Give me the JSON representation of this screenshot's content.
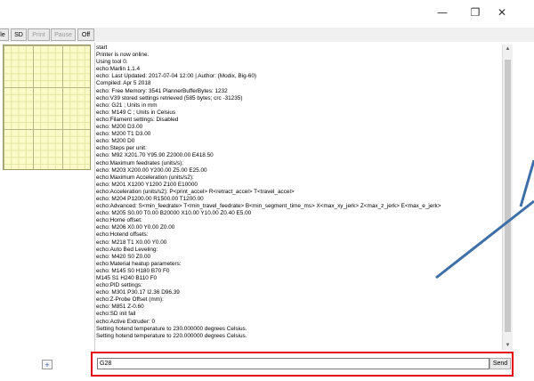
{
  "window": {
    "minimize_glyph": "—",
    "restore_glyph": "❐",
    "close_glyph": "✕"
  },
  "toolbar": {
    "buttons": [
      {
        "label": "le",
        "enabled": true
      },
      {
        "label": "SD",
        "enabled": true
      },
      {
        "label": "Print",
        "enabled": false
      },
      {
        "label": "Pause",
        "enabled": false
      },
      {
        "label": "Off",
        "enabled": true
      }
    ]
  },
  "left_pane": {
    "add_label": "+"
  },
  "console": {
    "lines": [
      "start",
      "Printer is now online.",
      "Using tool 0.",
      "echo:Marlin 1.1.4",
      "echo: Last Updated: 2017-07-04 12:00 | Author: (Modix, Big-60)",
      "Compiled: Apr  5 2018",
      "echo: Free Memory: 3541  PlannerBufferBytes: 1232",
      "echo:V39 stored settings retrieved (585 bytes; crc -31235)",
      "echo:  G21    ; Units in mm",
      "echo:  M149 C ; Units in Celsius",
      "echo:Filament settings: Disabled",
      "echo:  M200 D3.00",
      "echo:  M200 T1 D3.00",
      "echo:  M200 D0",
      "echo:Steps per unit:",
      "echo:  M92 X201.70 Y95.90 Z2000.00 E418.50",
      "echo:Maximum feedrates (units/s):",
      "echo:  M203 X200.00 Y200.00 Z5.00 E25.00",
      "echo:Maximum Acceleration (units/s2):",
      "echo:  M201 X1200 Y1200 Z100 E10000",
      "echo:Acceleration (units/s2): P<print_accel> R<retract_accel> T<travel_accel>",
      "echo:  M204 P1200.00 R1500.00 T1200.00",
      "echo:Advanced: S<min_feedrate> T<min_travel_feedrate> B<min_segment_time_ms> X<max_xy_jerk> Z<max_z_jerk> E<max_e_jerk>",
      "echo:  M205 S0.00 T0.00 B20000 X10.00 Y10.00 Z0.40 E5.00",
      "echo:Home offset:",
      "echo:  M206 X0.00 Y0.00 Z0.00",
      "echo:Hotend offsets:",
      "echo:  M218 T1 X0.00 Y0.00",
      "echo:Auto Bed Leveling:",
      "echo:  M420 S0 Z0.00",
      "echo:Material heatup parameters:",
      "echo:  M145 S0 H180 B70 F0",
      "  M145 S1 H240 B110 F0",
      "echo:PID settings:",
      "echo:  M301 P30.17 I2.36 D96.39",
      "echo:Z-Probe Offset (mm):",
      "echo:  M851 Z-0.60",
      "echo:SD init fail",
      "echo:Active Extruder: 0",
      "Setting hotend temperature to 230.000000 degrees Celsius.",
      "Setting hotend temperature to 220.000000 degrees Celsius."
    ]
  },
  "command": {
    "value": "G28",
    "send_label": "Send"
  },
  "colors": {
    "highlight": "#e30613",
    "arrow": "#3f6fa8",
    "grid_fill": "#fbfbc9"
  }
}
